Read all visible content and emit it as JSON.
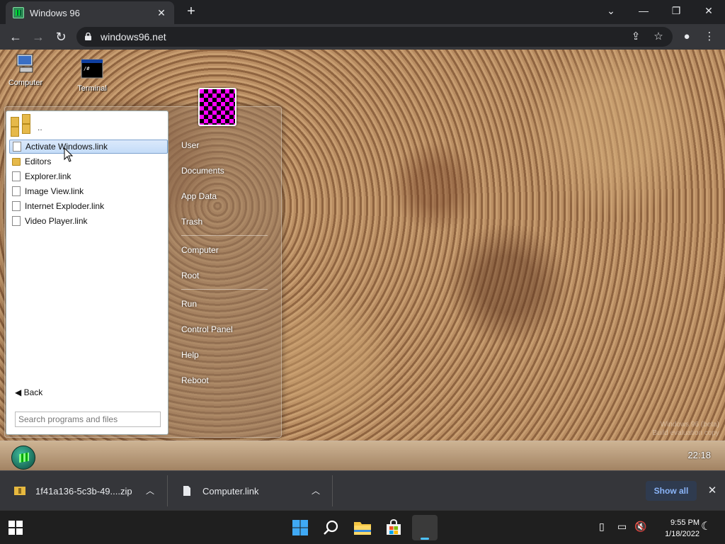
{
  "browser": {
    "tab_title": "Windows 96",
    "tab_close": "✕",
    "new_tab": "+",
    "url": "windows96.net"
  },
  "desktop": {
    "icons": [
      {
        "label": "Computer"
      },
      {
        "label": "Terminal"
      }
    ],
    "watermark_line1": "Windows 96 (beta)",
    "watermark_line2": "Build evaluation copy"
  },
  "start_menu": {
    "up_label": "..",
    "items": [
      {
        "label": "Activate Windows.link",
        "type": "file",
        "selected": true
      },
      {
        "label": "Editors",
        "type": "folder"
      },
      {
        "label": "Explorer.link",
        "type": "file"
      },
      {
        "label": "Image View.link",
        "type": "file"
      },
      {
        "label": "Internet Exploder.link",
        "type": "file"
      },
      {
        "label": "Video Player.link",
        "type": "file"
      }
    ],
    "back_label": "◀ Back",
    "search_placeholder": "Search programs and files",
    "links_group1": [
      "User",
      "Documents",
      "App Data",
      "Trash"
    ],
    "links_group2": [
      "Computer",
      "Root"
    ],
    "links_group3": [
      "Run",
      "Control Panel",
      "Help",
      "Reboot"
    ]
  },
  "w96_taskbar": {
    "clock": "22:18"
  },
  "downloads": {
    "items": [
      {
        "name": "1f41a136-5c3b-49....zip"
      },
      {
        "name": "Computer.link"
      }
    ],
    "show_all": "Show all"
  },
  "os_taskbar": {
    "time": "9:55 PM",
    "date": "1/18/2022"
  },
  "colors": {
    "selection": "#c4dcf8",
    "chrome_dark": "#202124",
    "chrome_toolbar": "#35363a",
    "show_all_link": "#8ab4f8",
    "avatar_magenta": "#ff00ff"
  }
}
